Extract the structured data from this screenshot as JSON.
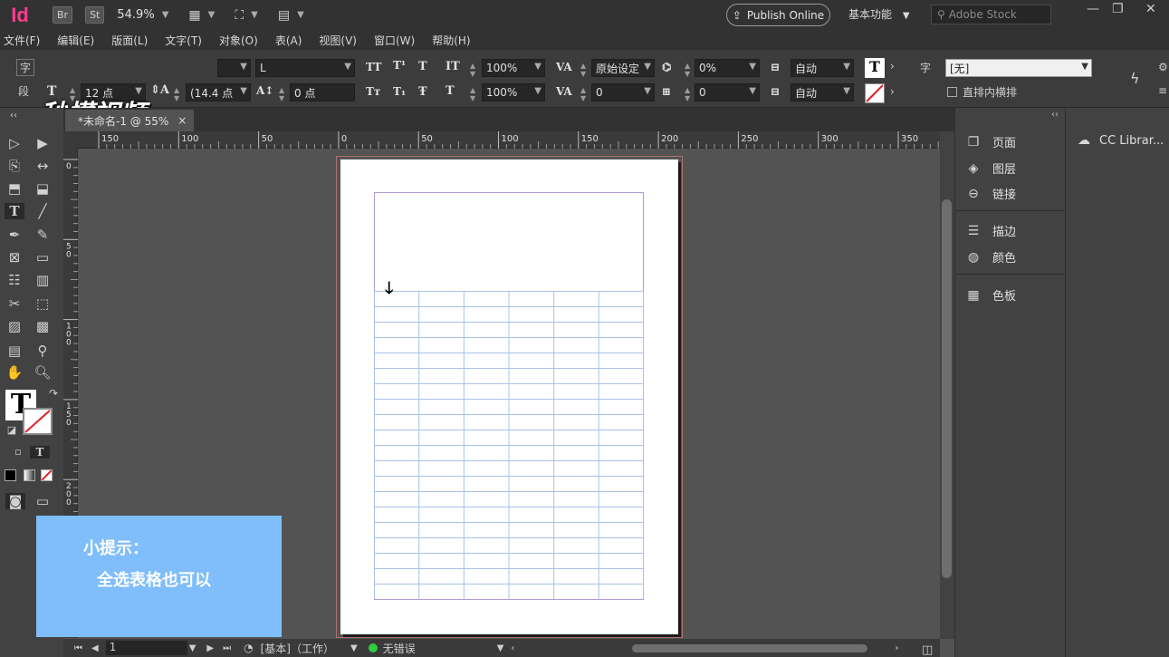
{
  "app": {
    "logo": "Id",
    "bridge_btn": "Br",
    "stock_btn": "St",
    "zoom": "54.9%",
    "publish_label": "Publish Online",
    "workspace": "基本功能",
    "stock_placeholder": "Adobe Stock"
  },
  "menu": [
    "文件(F)",
    "编辑(E)",
    "版面(L)",
    "文字(T)",
    "对象(O)",
    "表(A)",
    "视图(V)",
    "窗口(W)",
    "帮助(H)"
  ],
  "watermark": "秒懂视频",
  "control": {
    "font_style": "L",
    "font_size": "12 点",
    "leading": "(14.4 点",
    "tracking_baseline": "0 点",
    "vscale": "100%",
    "hscale": "100%",
    "kerning": "原始设定",
    "tracking": "0",
    "skew": "0%",
    "skew2": "0",
    "auto1": "自动",
    "auto2": "自动",
    "char_style": "[无]",
    "vertical_label": "直排内横排",
    "para_label": "段",
    "char_label": "字"
  },
  "document": {
    "tab_title": "*未命名-1 @ 55%",
    "close": "×"
  },
  "ruler": {
    "h_ticks": [
      "150",
      "100",
      "50",
      "0",
      "50",
      "100",
      "150",
      "200",
      "250",
      "300",
      "350"
    ],
    "v_ticks": [
      "0",
      "5\n0",
      "1\n0\n0",
      "1\n5\n0",
      "2\n0\n0"
    ]
  },
  "panels": {
    "pages": "页面",
    "layers": "图层",
    "links": "链接",
    "stroke": "描边",
    "color": "颜色",
    "swatches": "色板",
    "cc_libraries": "CC Librar..."
  },
  "status": {
    "page": "1",
    "style": "[基本]（工作）",
    "errors": "无错误"
  },
  "tip": {
    "title": "小提示：",
    "body": "全选表格也可以"
  },
  "colors": {
    "tip_bg": "#7fbefa",
    "status_ok": "#2ecc40",
    "logo": "#ff3b8a"
  }
}
